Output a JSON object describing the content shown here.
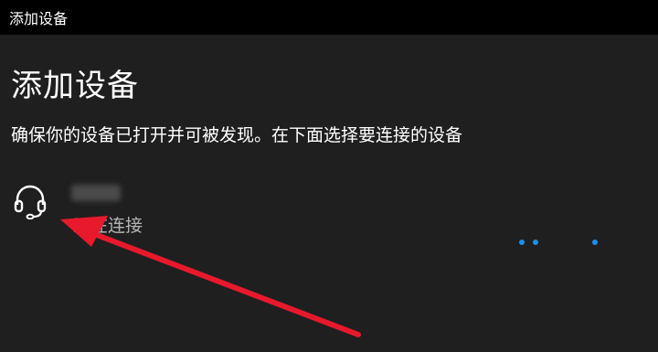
{
  "window": {
    "title": "添加设备"
  },
  "main": {
    "heading": "添加设备",
    "description": "确保你的设备已打开并可被发现。在下面选择要连接的设备"
  },
  "device": {
    "icon": "headset-icon",
    "status": "正在连接"
  },
  "colors": {
    "accent": "#1c8fe6",
    "annotation_arrow": "#e8192c"
  }
}
